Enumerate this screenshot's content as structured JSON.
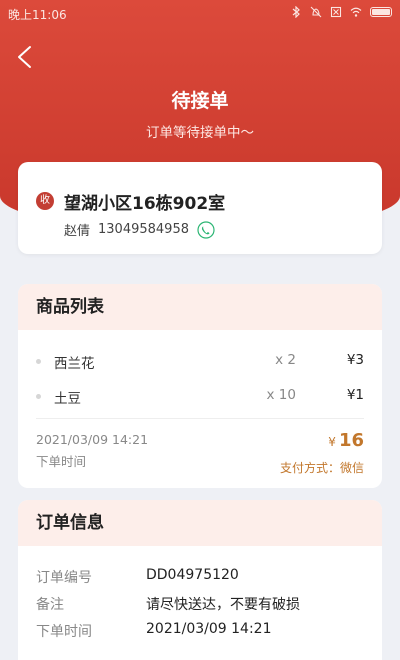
{
  "status_bar": {
    "time": "晚上11:06"
  },
  "header": {
    "title": "待接单",
    "subtitle": "订单等待接单中～"
  },
  "address": {
    "badge": "收",
    "line": "望湖小区16栋902室",
    "name": "赵倩",
    "phone": "13049584958"
  },
  "goods": {
    "title": "商品列表",
    "items": [
      {
        "name": "西兰花",
        "qty": "x 2",
        "price": "¥3"
      },
      {
        "name": "土豆",
        "qty": "x 10",
        "price": "¥1"
      }
    ],
    "order_time": "2021/03/09 14:21",
    "order_time_label": "下单时间",
    "currency": "¥",
    "total": "16",
    "pay_method": "支付方式：微信"
  },
  "order_info": {
    "title": "订单信息",
    "rows": [
      {
        "label": "订单编号",
        "value": "DD04975120"
      },
      {
        "label": "备注",
        "value": "请尽快送达，不要有破损"
      },
      {
        "label": "下单时间",
        "value": "2021/03/09 14:21"
      }
    ]
  },
  "colors": {
    "header": "#d44537",
    "accent": "#c2772c",
    "badge": "#c33e33",
    "phone": "#2bb573"
  },
  "icons": [
    "back-arrow-icon",
    "phone-icon",
    "bluetooth-icon",
    "mute-icon",
    "sim-icon",
    "wifi-icon",
    "battery-icon"
  ]
}
